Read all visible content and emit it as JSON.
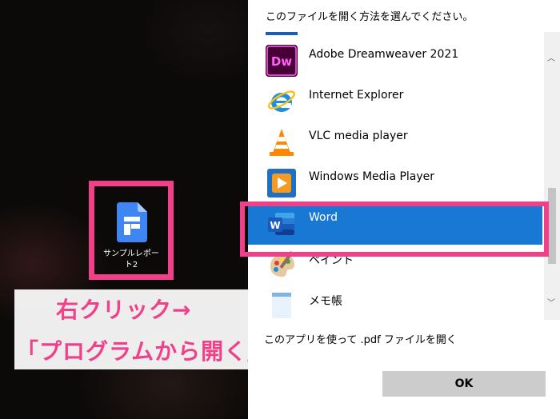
{
  "desktop": {
    "file_icon": {
      "label_line1": "サンプルレポー",
      "label_line2": "ト2",
      "icon": "google-docs-file-icon"
    }
  },
  "callout": {
    "line1": "右クリック→",
    "line2": "「プログラムから開く」"
  },
  "dialog": {
    "title": "このファイルを開く方法を選んでください。",
    "apps": [
      {
        "label": "Adobe Dreamweaver 2021",
        "icon": "dreamweaver-icon"
      },
      {
        "label": "Internet Explorer",
        "icon": "internet-explorer-icon"
      },
      {
        "label": "VLC media player",
        "icon": "vlc-cone-icon"
      },
      {
        "label": "Windows Media Player",
        "icon": "windows-media-player-icon"
      },
      {
        "label": "Word",
        "icon": "word-icon",
        "selected": true
      },
      {
        "label": "ペイント",
        "icon": "paint-palette-icon"
      },
      {
        "label": "メモ帳",
        "icon": "notepad-icon"
      }
    ],
    "always_use_label": "このアプリを使って .pdf ファイルを開く",
    "ok_label": "OK"
  },
  "colors": {
    "accent_pink": "#f0408a",
    "selection_blue": "#1978d4"
  }
}
